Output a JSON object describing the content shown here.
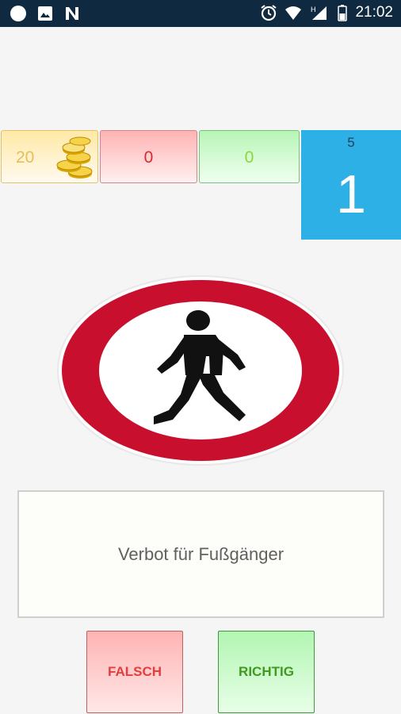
{
  "status_bar": {
    "time": "21:02",
    "network_letter": "H",
    "icons": [
      "circle-notification-icon",
      "image-icon",
      "n-app-icon",
      "alarm-icon",
      "wifi-icon",
      "signal-icon",
      "battery-icon"
    ]
  },
  "score": {
    "coins": "20",
    "wrong": "0",
    "correct": "0"
  },
  "level": {
    "total": "5",
    "current": "1"
  },
  "question": {
    "sign_icon": "no-pedestrians-sign",
    "answer_text": "Verbot für Fußgänger"
  },
  "buttons": {
    "false_label": "FALSCH",
    "true_label": "RICHTIG"
  },
  "colors": {
    "status_bar": "#0f2a40",
    "level_box": "#2db0e5",
    "sign_red": "#c8102e",
    "wrong_text": "#d92b2b",
    "correct_text": "#8fd43a"
  }
}
